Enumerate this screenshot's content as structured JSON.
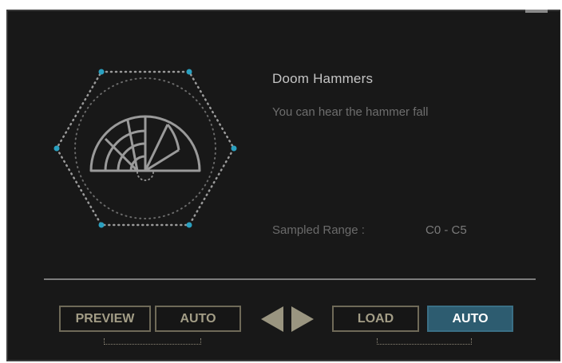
{
  "instrument": {
    "name": "Doom Hammers",
    "description": "You can hear the hammer fall",
    "range_label": "Sampled Range :",
    "range_value": "C0 - C5"
  },
  "buttons": {
    "preview": "PREVIEW",
    "auto_left": "AUTO",
    "load": "LOAD",
    "auto_right": "AUTO"
  },
  "icons": {
    "emblem": "hexagon-hammer-icon",
    "prev": "arrow-left-icon",
    "next": "arrow-right-icon"
  },
  "colors": {
    "panel_bg": "#181818",
    "accent_active": "#2d5c70",
    "button_border": "#6f6a58",
    "button_text": "#a39d86",
    "hexagon_node": "#2aa0c0"
  }
}
